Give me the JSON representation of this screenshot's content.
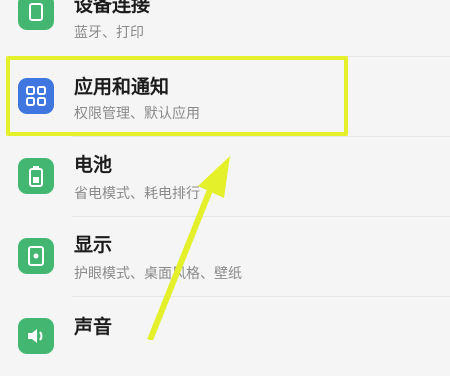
{
  "settings": {
    "items": [
      {
        "title": "设备连接",
        "subtitle": "蓝牙、打印",
        "icon": "device-connection-icon",
        "color": "#43b772"
      },
      {
        "title": "应用和通知",
        "subtitle": "权限管理、默认应用",
        "icon": "apps-grid-icon",
        "color": "#3f76e0"
      },
      {
        "title": "电池",
        "subtitle": "省电模式、耗电排行",
        "icon": "battery-icon",
        "color": "#43b772"
      },
      {
        "title": "显示",
        "subtitle": "护眼模式、桌面风格、壁纸",
        "icon": "display-icon",
        "color": "#43b772"
      },
      {
        "title": "声音",
        "subtitle": "",
        "icon": "sound-icon",
        "color": "#43b772"
      }
    ]
  },
  "annotation": {
    "highlight_color": "#e4f02a",
    "arrow_color": "#e4f02a"
  }
}
